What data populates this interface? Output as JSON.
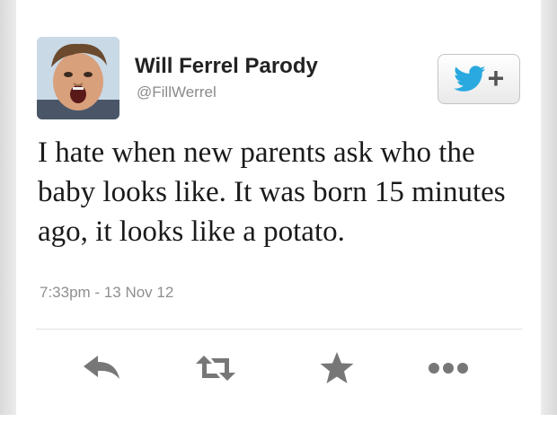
{
  "tweet": {
    "display_name": "Will Ferrel Parody",
    "handle": "@FillWerrel",
    "text": "I hate when new parents ask who the baby looks like. It was born 15 minutes ago, it looks like a potato.",
    "timestamp": "7:33pm - 13 Nov 12"
  },
  "follow_button": {
    "icon": "twitter-bird-icon",
    "label": "+"
  },
  "actions": [
    {
      "name": "reply",
      "icon": "reply-icon"
    },
    {
      "name": "retweet",
      "icon": "retweet-icon"
    },
    {
      "name": "favorite",
      "icon": "star-icon"
    },
    {
      "name": "more",
      "icon": "more-icon"
    }
  ],
  "colors": {
    "text": "#1a1a1a",
    "secondary_text": "#8a8a8a",
    "icon_grey": "#777777",
    "twitter_blue": "#2aa9e0",
    "side_band": "#d9d9d9"
  }
}
